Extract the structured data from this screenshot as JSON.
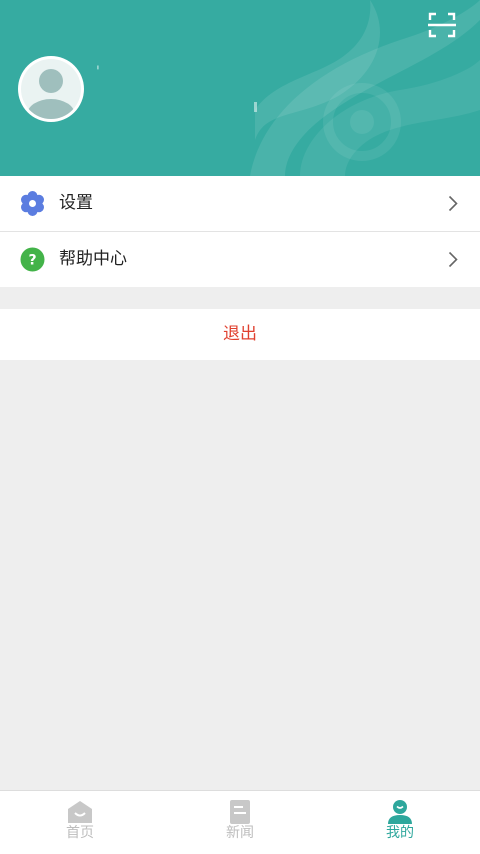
{
  "colors": {
    "header_bg": "#36aba1",
    "accent": "#2ea79c",
    "logout_text": "#e0402f",
    "settings_icon": "#5b7de0",
    "help_icon": "#43b349",
    "page_bg": "#eeeeee"
  },
  "header": {
    "scan_icon": "scan-icon",
    "avatar_icon": "default-avatar",
    "username": "'"
  },
  "menu": {
    "items": [
      {
        "label": "设置",
        "icon": "gear-icon"
      },
      {
        "label": "帮助中心",
        "icon": "help-icon"
      }
    ]
  },
  "logout": {
    "label": "退出"
  },
  "tabbar": {
    "tabs": [
      {
        "label": "首页",
        "icon": "home-icon",
        "active": false
      },
      {
        "label": "新闻",
        "icon": "news-icon",
        "active": false
      },
      {
        "label": "我的",
        "icon": "profile-icon",
        "active": true
      }
    ]
  }
}
